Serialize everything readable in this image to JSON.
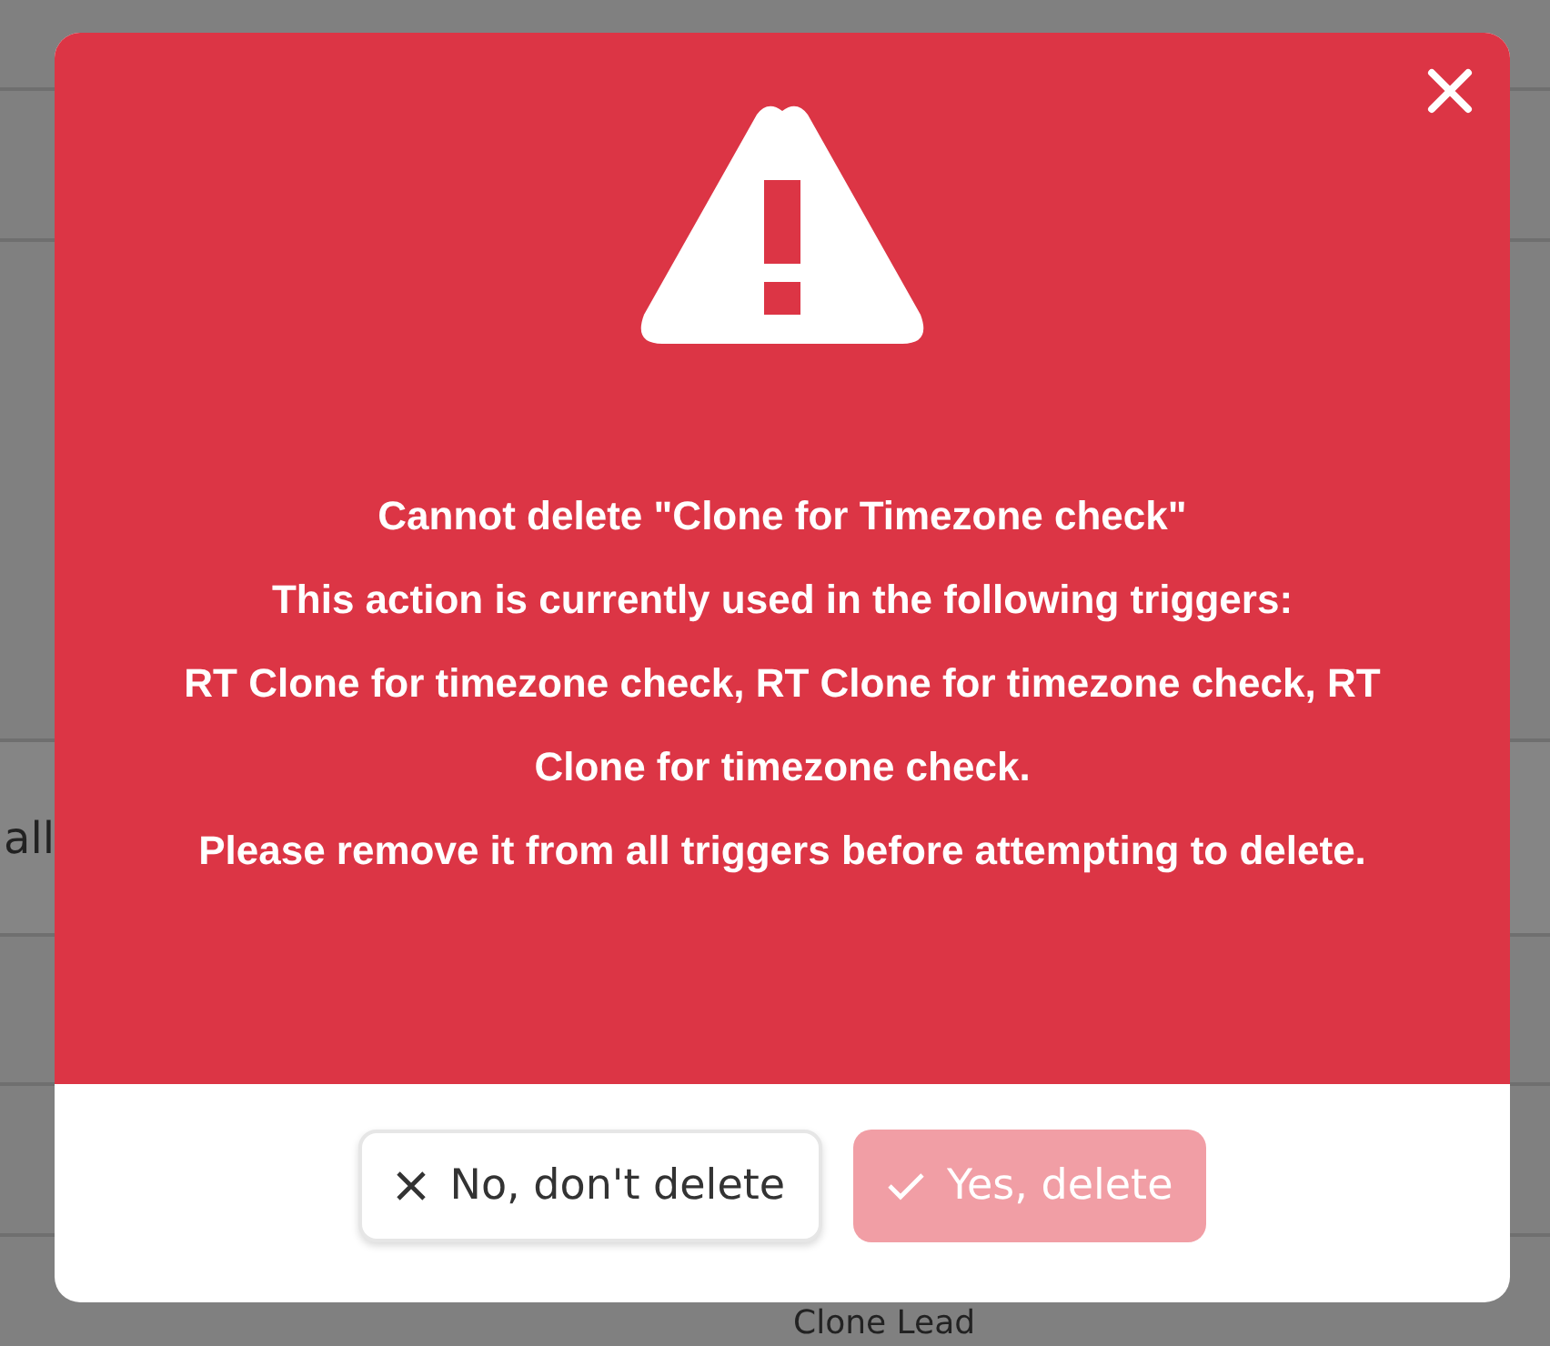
{
  "background": {
    "row_text": "all",
    "bottom_text": "Clone Lead"
  },
  "dialog": {
    "message_lines": [
      "Cannot delete \"Clone for Timezone check\"",
      "This action is currently used in the following triggers:",
      "RT Clone for timezone check, RT Clone for timezone check, RT Clone for timezone check.",
      "Please remove it from all triggers before attempting to delete."
    ],
    "buttons": [
      {
        "kind": "cancel",
        "label": "No, don't delete",
        "disabled": false
      },
      {
        "kind": "confirm",
        "label": "Yes, delete",
        "disabled": true
      }
    ]
  }
}
